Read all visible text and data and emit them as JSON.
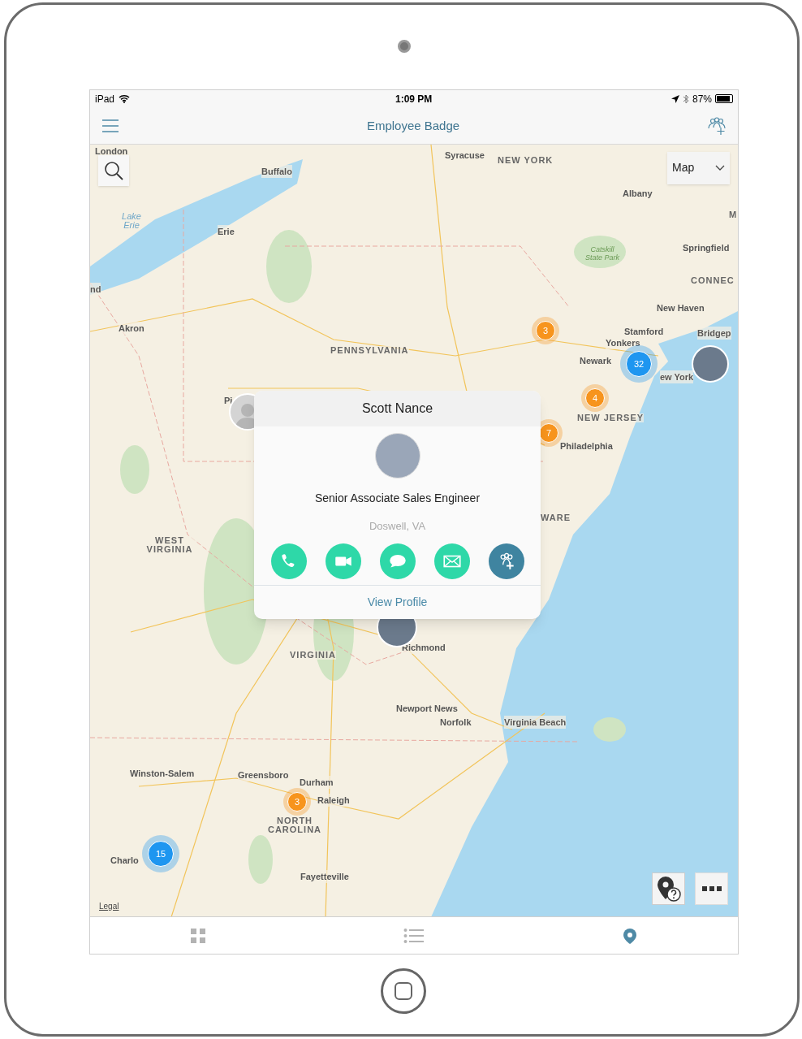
{
  "status_bar": {
    "carrier": "iPad",
    "time": "1:09 PM",
    "battery_text": "87%",
    "battery": {
      "level": 0.87
    }
  },
  "nav_bar": {
    "title": "Employee Badge"
  },
  "map": {
    "type_selector": "Map",
    "labels": [
      {
        "text": "London",
        "kind": "city"
      },
      {
        "text": "Buffalo",
        "kind": "city"
      },
      {
        "text": "Syracuse",
        "kind": "city"
      },
      {
        "text": "NEW YORK",
        "kind": "region"
      },
      {
        "text": "Albany",
        "kind": "city"
      },
      {
        "text": "Lake Erie",
        "kind": "water"
      },
      {
        "text": "Erie",
        "kind": "city"
      },
      {
        "text": "M",
        "kind": "region"
      },
      {
        "text": "Springfield",
        "kind": "city"
      },
      {
        "text": "Catskill State Park",
        "kind": "park"
      },
      {
        "text": "CONNEC",
        "kind": "region"
      },
      {
        "text": "nd",
        "kind": "city"
      },
      {
        "text": "New Haven",
        "kind": "city"
      },
      {
        "text": "Akron",
        "kind": "city"
      },
      {
        "text": "Stamford",
        "kind": "city"
      },
      {
        "text": "Bridgep",
        "kind": "city"
      },
      {
        "text": "Yonkers",
        "kind": "city"
      },
      {
        "text": "PENNSYLVANIA",
        "kind": "region"
      },
      {
        "text": "Newark",
        "kind": "city"
      },
      {
        "text": "ew York",
        "kind": "city"
      },
      {
        "text": "Pi",
        "kind": "city"
      },
      {
        "text": "NEW JERSEY",
        "kind": "region"
      },
      {
        "text": "Philadelphia",
        "kind": "city"
      },
      {
        "text": "WARE",
        "kind": "region"
      },
      {
        "text": "WEST VIRGINIA",
        "kind": "region"
      },
      {
        "text": "Richmond",
        "kind": "city"
      },
      {
        "text": "VIRGINIA",
        "kind": "region"
      },
      {
        "text": "Newport News",
        "kind": "city"
      },
      {
        "text": "Norfolk",
        "kind": "city"
      },
      {
        "text": "Virginia Beach",
        "kind": "city"
      },
      {
        "text": "Winston-Salem",
        "kind": "city"
      },
      {
        "text": "Greensboro",
        "kind": "city"
      },
      {
        "text": "Durham",
        "kind": "city"
      },
      {
        "text": "Raleigh",
        "kind": "city"
      },
      {
        "text": "NORTH CAROLINA",
        "kind": "region"
      },
      {
        "text": "Charlo",
        "kind": "city"
      },
      {
        "text": "Fayetteville",
        "kind": "city"
      }
    ],
    "clusters": [
      {
        "count": "3",
        "color": "#f7941d"
      },
      {
        "count": "32",
        "color": "#1e96f0"
      },
      {
        "count": "4",
        "color": "#f7941d"
      },
      {
        "count": "7",
        "color": "#f7941d"
      },
      {
        "count": "3",
        "color": "#f7941d"
      },
      {
        "count": "15",
        "color": "#1e96f0"
      }
    ],
    "pins": [
      {
        "kind": "photo"
      },
      {
        "kind": "silhouette"
      },
      {
        "kind": "photo"
      }
    ],
    "legal_link": "Legal"
  },
  "popup": {
    "name": "Scott Nance",
    "title": "Senior Associate Sales Engineer",
    "location": "Doswell, VA",
    "actions": [
      {
        "kind": "call"
      },
      {
        "kind": "video"
      },
      {
        "kind": "message"
      },
      {
        "kind": "email"
      },
      {
        "kind": "add-contact"
      }
    ],
    "link": "View Profile"
  },
  "tab_bar": [
    {
      "kind": "grid",
      "selected": false
    },
    {
      "kind": "list",
      "selected": false
    },
    {
      "kind": "map",
      "selected": true
    }
  ]
}
